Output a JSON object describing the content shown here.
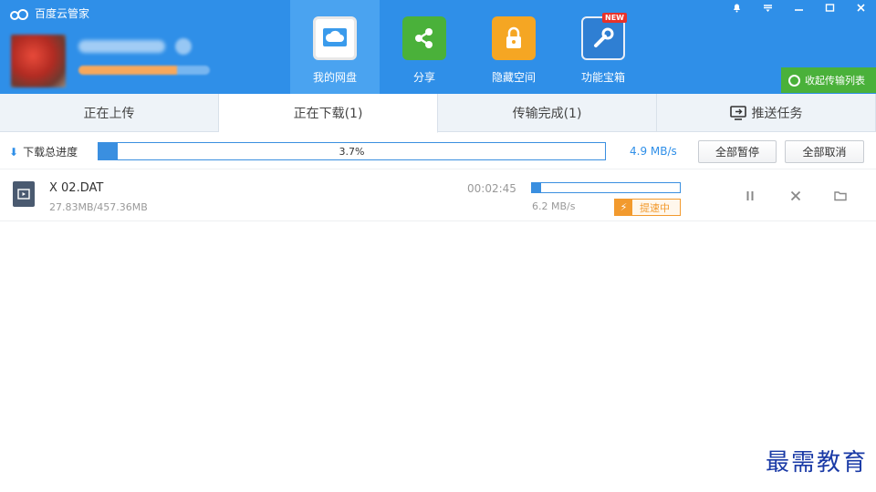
{
  "app": {
    "title": "百度云管家"
  },
  "user": {
    "avatar": "avatar-blurred"
  },
  "nav": {
    "items": [
      {
        "label": "我的网盘",
        "icon": "cloud-icon",
        "active": true
      },
      {
        "label": "分享",
        "icon": "share-icon",
        "active": false
      },
      {
        "label": "隐藏空间",
        "icon": "lock-icon",
        "active": false
      },
      {
        "label": "功能宝箱",
        "icon": "toolbox-icon",
        "active": false,
        "badge": "NEW"
      }
    ]
  },
  "window_controls": [
    "bell-icon",
    "menu-icon",
    "minimize-icon",
    "maximize-icon",
    "close-icon"
  ],
  "collapse_button": {
    "label": "收起传输列表"
  },
  "tabs": [
    {
      "label": "正在上传",
      "active": false
    },
    {
      "label": "正在下载(1)",
      "active": true
    },
    {
      "label": "传输完成(1)",
      "active": false
    },
    {
      "label": "推送任务",
      "active": false,
      "icon": "push-icon"
    }
  ],
  "total": {
    "label": "下载总进度",
    "percent_text": "3.7%",
    "progress": 0.037,
    "speed": "4.9 MB/s",
    "pause_all": "全部暂停",
    "cancel_all": "全部取消"
  },
  "task": {
    "name": "X  02.DAT",
    "size": "27.83MB/457.36MB",
    "time_left": "00:02:45",
    "progress": 0.061,
    "speed": "6.2 MB/s",
    "boost": "提速中"
  },
  "watermark": "最需教育",
  "colors": {
    "header": "#2f8fe8",
    "accent": "#3a8fe0",
    "green": "#4ab13a",
    "orange": "#f29a2e"
  }
}
